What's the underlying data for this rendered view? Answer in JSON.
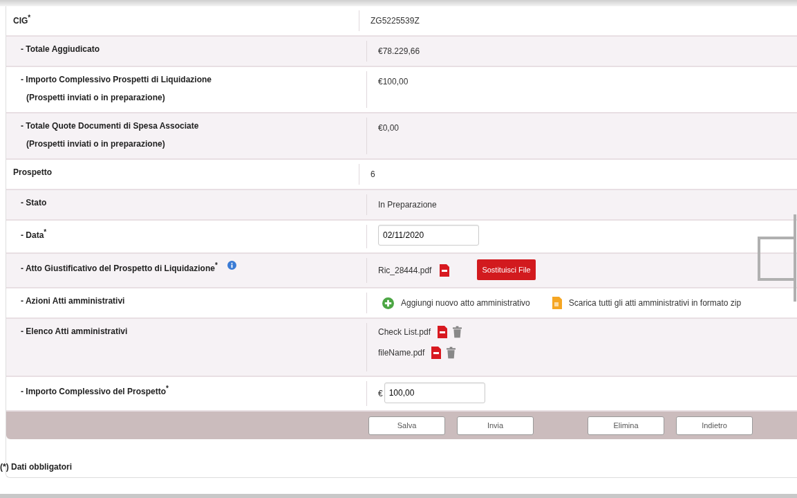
{
  "rows": [
    {
      "kind": "section",
      "label": "CIG$^{*}$",
      "value": {
        "kind": "text",
        "text": "ZG5225539Z"
      }
    },
    {
      "kind": "item",
      "label": "- Totale Aggiudicato",
      "value": {
        "kind": "text",
        "text": "€78.229,66"
      }
    },
    {
      "kind": "item",
      "label": "- Importo Complessivo Prospetti di Liquidazione",
      "note": "(Prospetti inviati o in preparazione)",
      "value": {
        "kind": "text",
        "text": "€100,00"
      }
    },
    {
      "kind": "item",
      "label": "- Totale Quote Documenti di Spesa Associate",
      "note": "(Prospetti inviati o in preparazione)",
      "value": {
        "kind": "text",
        "text": "€0,00"
      }
    },
    {
      "kind": "section",
      "label": "Prospetto",
      "value": {
        "kind": "text",
        "text": "6"
      }
    },
    {
      "kind": "item",
      "label": "- Stato",
      "value": {
        "kind": "text",
        "text": "In Preparazione"
      }
    },
    {
      "kind": "item",
      "label": "- Data$^{*}$",
      "value": {
        "kind": "date",
        "text": "02/11/2020"
      }
    },
    {
      "kind": "item",
      "label": "- Atto Giustificativo del Prospetto di Liquidazione$^{*}$",
      "info": true,
      "value": {
        "kind": "file",
        "file_name": "Ric_28444.pdf",
        "button": "Sostituisci File"
      }
    },
    {
      "kind": "item",
      "label": "- Azioni Atti amministrativi",
      "value": {
        "kind": "actions",
        "actions": [
          {
            "kind": "add",
            "label": "Aggiungi nuovo atto amministrativo"
          },
          {
            "kind": "download",
            "label": "Scarica tutti gli atti amministrativi in formato zip"
          }
        ]
      }
    },
    {
      "kind": "item",
      "label": "- Elenco Atti amministrativi",
      "value": {
        "kind": "files",
        "files": [
          {
            "name": "Check List.pdf"
          },
          {
            "name": "fileName.pdf"
          }
        ]
      }
    },
    {
      "kind": "item",
      "label": "- Importo Complessivo del Prospetto$^{*}$",
      "value": {
        "kind": "amount",
        "currency": "€",
        "text": "100,00"
      }
    }
  ],
  "buttons": [
    {
      "label": "Salva"
    },
    {
      "label": "Invia"
    },
    {
      "label": "Elimina"
    },
    {
      "label": "Indietro"
    }
  ],
  "footnote": "(*) Dati obbligatori"
}
